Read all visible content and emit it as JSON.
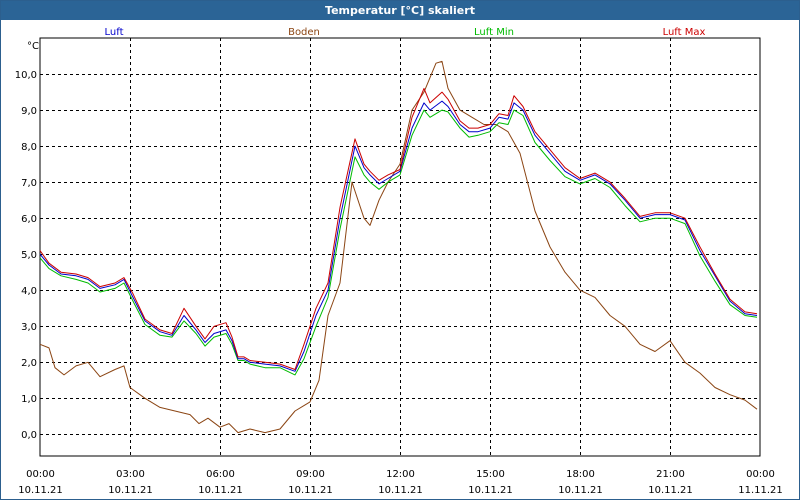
{
  "window": {
    "title": "Temperatur [°C] skaliert"
  },
  "chart_data": {
    "type": "line",
    "title": "Temperatur [°C] skaliert",
    "ylabel": "°C",
    "xlabel": "",
    "ylim": [
      -0.6,
      11.0
    ],
    "xlim": [
      0,
      24
    ],
    "yticks": [
      0.0,
      1.0,
      2.0,
      3.0,
      4.0,
      5.0,
      6.0,
      7.0,
      8.0,
      9.0,
      10.0
    ],
    "ytick_labels": [
      "0,0",
      "1,0",
      "2,0",
      "3,0",
      "4,0",
      "5,0",
      "6,0",
      "7,0",
      "8,0",
      "9,0",
      "10,0"
    ],
    "xticks": [
      {
        "x": 0,
        "time": "00:00",
        "date": "10.11.21"
      },
      {
        "x": 3,
        "time": "03:00",
        "date": "10.11.21"
      },
      {
        "x": 6,
        "time": "06:00",
        "date": "10.11.21"
      },
      {
        "x": 9,
        "time": "09:00",
        "date": "10.11.21"
      },
      {
        "x": 12,
        "time": "12:00",
        "date": "10.11.21"
      },
      {
        "x": 15,
        "time": "15:00",
        "date": "10.11.21"
      },
      {
        "x": 18,
        "time": "18:00",
        "date": "10.11.21"
      },
      {
        "x": 21,
        "time": "21:00",
        "date": "10.11.21"
      },
      {
        "x": 24,
        "time": "00:00",
        "date": "11.11.21"
      }
    ],
    "grid": true,
    "legend_position": "top",
    "x_unit": "hours",
    "series": [
      {
        "name": "Luft",
        "color": "#0000cc",
        "x": [
          0,
          0.3,
          0.7,
          1.2,
          1.6,
          2.0,
          2.5,
          2.8,
          3.1,
          3.5,
          4.0,
          4.4,
          4.8,
          5.2,
          5.5,
          5.8,
          6.2,
          6.4,
          6.6,
          6.8,
          7.0,
          7.5,
          8.0,
          8.5,
          8.8,
          9.2,
          9.6,
          10.0,
          10.5,
          10.8,
          11.0,
          11.3,
          11.6,
          12.0,
          12.4,
          12.8,
          13.0,
          13.4,
          13.6,
          14.0,
          14.3,
          14.6,
          15.0,
          15.3,
          15.6,
          15.8,
          16.1,
          16.5,
          17.0,
          17.5,
          18.0,
          18.5,
          19.0,
          19.5,
          20.0,
          20.5,
          21.0,
          21.5,
          22.0,
          22.5,
          23.0,
          23.5,
          23.9
        ],
        "y": [
          5.0,
          4.7,
          4.45,
          4.4,
          4.3,
          4.05,
          4.15,
          4.3,
          3.8,
          3.15,
          2.85,
          2.75,
          3.3,
          2.9,
          2.55,
          2.8,
          2.9,
          2.6,
          2.1,
          2.1,
          2.0,
          1.95,
          1.9,
          1.75,
          2.3,
          3.3,
          4.0,
          6.0,
          8.0,
          7.4,
          7.2,
          6.95,
          7.1,
          7.3,
          8.5,
          9.2,
          9.0,
          9.25,
          9.1,
          8.6,
          8.4,
          8.4,
          8.5,
          8.8,
          8.75,
          9.2,
          9.0,
          8.3,
          7.8,
          7.3,
          7.05,
          7.2,
          6.95,
          6.5,
          6.0,
          6.1,
          6.1,
          5.95,
          5.1,
          4.4,
          3.7,
          3.35,
          3.3
        ]
      },
      {
        "name": "Boden",
        "color": "#8b4513",
        "x": [
          0,
          0.3,
          0.5,
          0.8,
          1.2,
          1.6,
          2.0,
          2.5,
          2.8,
          3.0,
          3.5,
          4.0,
          4.5,
          5.0,
          5.3,
          5.6,
          6.0,
          6.3,
          6.6,
          7.0,
          7.5,
          8.0,
          8.5,
          8.8,
          9.0,
          9.3,
          9.6,
          10.0,
          10.4,
          10.8,
          11.0,
          11.3,
          11.6,
          12.0,
          12.4,
          12.8,
          13.2,
          13.4,
          13.6,
          14.0,
          14.4,
          14.8,
          15.2,
          15.6,
          16.0,
          16.5,
          17.0,
          17.5,
          18.0,
          18.5,
          19.0,
          19.5,
          20.0,
          20.5,
          21.0,
          21.5,
          22.0,
          22.5,
          23.0,
          23.5,
          23.9
        ],
        "y": [
          2.5,
          2.4,
          1.85,
          1.65,
          1.9,
          2.0,
          1.6,
          1.8,
          1.9,
          1.3,
          1.0,
          0.75,
          0.65,
          0.55,
          0.3,
          0.45,
          0.2,
          0.3,
          0.05,
          0.15,
          0.05,
          0.15,
          0.65,
          0.8,
          0.9,
          1.5,
          3.3,
          4.2,
          7.0,
          6.0,
          5.8,
          6.5,
          7.0,
          7.5,
          9.0,
          9.5,
          10.3,
          10.35,
          9.6,
          9.0,
          8.8,
          8.6,
          8.6,
          8.4,
          7.8,
          6.2,
          5.2,
          4.5,
          4.0,
          3.8,
          3.3,
          3.0,
          2.5,
          2.3,
          2.6,
          2.0,
          1.7,
          1.3,
          1.1,
          0.95,
          0.7
        ]
      },
      {
        "name": "Luft Min",
        "color": "#00bb00",
        "x": [
          0,
          0.3,
          0.7,
          1.2,
          1.6,
          2.0,
          2.5,
          2.8,
          3.1,
          3.5,
          4.0,
          4.4,
          4.8,
          5.2,
          5.5,
          5.8,
          6.2,
          6.4,
          6.6,
          6.8,
          7.0,
          7.5,
          8.0,
          8.5,
          8.8,
          9.2,
          9.6,
          10.0,
          10.5,
          10.8,
          11.0,
          11.3,
          11.6,
          12.0,
          12.4,
          12.8,
          13.0,
          13.4,
          13.6,
          14.0,
          14.3,
          14.6,
          15.0,
          15.3,
          15.6,
          15.8,
          16.1,
          16.5,
          17.0,
          17.5,
          18.0,
          18.5,
          19.0,
          19.5,
          20.0,
          20.5,
          21.0,
          21.5,
          22.0,
          22.5,
          23.0,
          23.5,
          23.9
        ],
        "y": [
          4.9,
          4.6,
          4.4,
          4.3,
          4.2,
          3.95,
          4.05,
          4.2,
          3.7,
          3.05,
          2.75,
          2.7,
          3.15,
          2.8,
          2.45,
          2.7,
          2.8,
          2.5,
          2.05,
          2.05,
          1.95,
          1.85,
          1.85,
          1.65,
          2.1,
          3.0,
          3.8,
          5.7,
          7.7,
          7.2,
          7.0,
          6.8,
          7.0,
          7.2,
          8.3,
          9.0,
          8.8,
          9.0,
          8.95,
          8.5,
          8.25,
          8.3,
          8.4,
          8.65,
          8.6,
          9.0,
          8.85,
          8.1,
          7.6,
          7.15,
          6.95,
          7.1,
          6.85,
          6.35,
          5.9,
          6.0,
          6.0,
          5.85,
          4.95,
          4.25,
          3.6,
          3.3,
          3.25
        ]
      },
      {
        "name": "Luft Max",
        "color": "#cc0000",
        "x": [
          0,
          0.3,
          0.7,
          1.2,
          1.6,
          2.0,
          2.5,
          2.8,
          3.1,
          3.5,
          4.0,
          4.4,
          4.8,
          5.2,
          5.5,
          5.8,
          6.2,
          6.4,
          6.6,
          6.8,
          7.0,
          7.5,
          8.0,
          8.5,
          8.8,
          9.2,
          9.6,
          10.0,
          10.5,
          10.8,
          11.0,
          11.3,
          11.6,
          12.0,
          12.4,
          12.8,
          13.0,
          13.4,
          13.6,
          14.0,
          14.3,
          14.6,
          15.0,
          15.3,
          15.6,
          15.8,
          16.1,
          16.5,
          17.0,
          17.5,
          18.0,
          18.5,
          19.0,
          19.5,
          20.0,
          20.5,
          21.0,
          21.5,
          22.0,
          22.5,
          23.0,
          23.5,
          23.9
        ],
        "y": [
          5.1,
          4.75,
          4.5,
          4.45,
          4.35,
          4.1,
          4.2,
          4.35,
          3.9,
          3.2,
          2.9,
          2.8,
          3.5,
          3.0,
          2.65,
          3.0,
          3.1,
          2.7,
          2.15,
          2.15,
          2.05,
          2.0,
          1.95,
          1.8,
          2.5,
          3.5,
          4.2,
          6.3,
          8.2,
          7.5,
          7.3,
          7.05,
          7.2,
          7.35,
          8.8,
          9.6,
          9.2,
          9.5,
          9.3,
          8.7,
          8.5,
          8.5,
          8.6,
          8.9,
          8.85,
          9.4,
          9.1,
          8.4,
          7.9,
          7.4,
          7.1,
          7.25,
          7.0,
          6.55,
          6.05,
          6.15,
          6.15,
          6.0,
          5.2,
          4.45,
          3.75,
          3.4,
          3.35
        ]
      }
    ]
  }
}
